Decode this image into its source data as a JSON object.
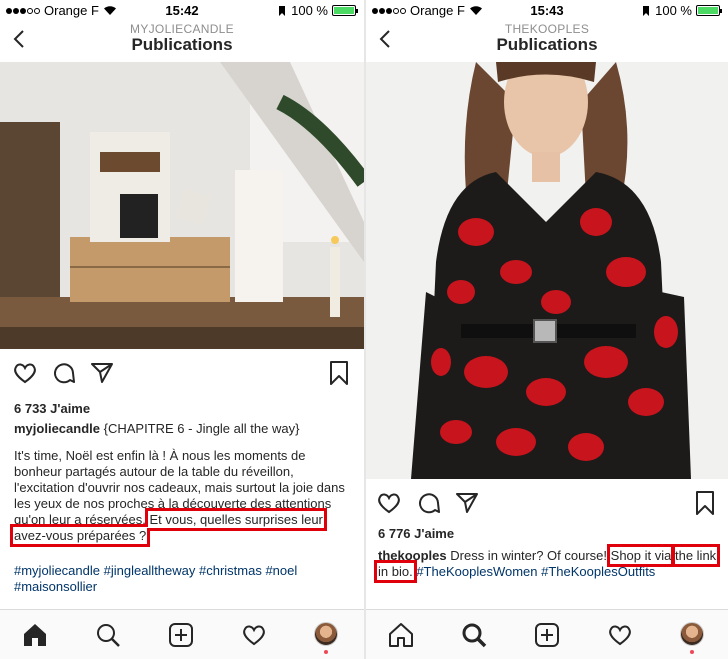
{
  "colors": {
    "accent_red": "#e0000b",
    "link_blue": "#003569",
    "battery_green": "#4cd964"
  },
  "left": {
    "status": {
      "carrier": "Orange F",
      "time": "15:42",
      "battery": "100 %"
    },
    "nav": {
      "account": "MYJOLIECANDLE",
      "title": "Publications"
    },
    "likes": "6 733 J'aime",
    "caption": {
      "user": "myjoliecandle",
      "first": "{CHAPITRE 6 - Jingle all the way}",
      "body": "It's time, Noël est enfin là ! À nous les moments de bonheur partagés autour de la table du réveillon, l'excitation d'ouvrir nos cadeaux, mais surtout la joie dans les yeux de nos proches à la découverte des attentions qu'on leur a réservées.",
      "highlight": "Et vous, quelles surprises leur avez-vous préparées ?",
      "tags": "#myjoliecandle #jinglealltheway #christmas #noel #maisonsollier"
    }
  },
  "right": {
    "status": {
      "carrier": "Orange F",
      "time": "15:43",
      "battery": "100 %"
    },
    "nav": {
      "account": "THEKOOPLES",
      "title": "Publications"
    },
    "likes": "6 776 J'aime",
    "caption": {
      "user": "thekooples",
      "text": "Dress in winter? Of course!",
      "highlight_a": "Shop it via",
      "highlight_b": "the link in bio.",
      "tag1": "#TheKooplesWomen",
      "tag2": "#TheKooplesOutfits"
    }
  },
  "icons": [
    "back-icon",
    "heart-icon",
    "comment-icon",
    "share-icon",
    "bookmark-icon",
    "home-icon",
    "search-icon",
    "add-icon",
    "activity-icon",
    "profile-avatar",
    "wifi-icon",
    "alarm-icon",
    "battery-icon"
  ]
}
